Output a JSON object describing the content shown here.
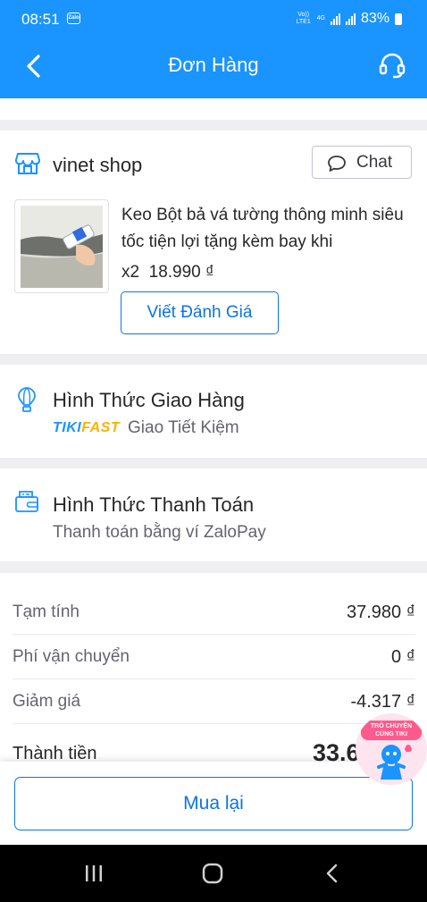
{
  "status_bar": {
    "time": "08:51",
    "notification_app": "Zalo",
    "volte_label": "Vo)) LTE1",
    "network_label": "4G",
    "battery": "83%"
  },
  "header": {
    "title": "Đơn Hàng",
    "back_icon": "chevron-left-icon",
    "support_icon": "headset-icon"
  },
  "shop": {
    "name": "vinet shop",
    "chat_label": "Chat"
  },
  "product": {
    "name": "Keo Bột bả vá tường thông minh siêu tốc tiện lợi tặng kèm bay khi",
    "quantity": "x2",
    "price": "18.990 ₫",
    "review_label": "Viết Đánh Giá"
  },
  "shipping": {
    "title": "Hình Thức Giao Hàng",
    "logo_tiki": "TIKI",
    "logo_fast": "FAST",
    "method": "Giao Tiết Kiệm"
  },
  "payment": {
    "title": "Hình Thức Thanh Toán",
    "method": "Thanh toán bằng ví ZaloPay"
  },
  "summary": {
    "rows": [
      {
        "label": "Tạm tính",
        "value": "37.980 ₫"
      },
      {
        "label": "Phí vận chuyển",
        "value": "0 ₫"
      },
      {
        "label": "Giảm giá",
        "value": "-4.317 ₫"
      }
    ],
    "total_label": "Thành tiền",
    "total_value": "33.6"
  },
  "bottom": {
    "rebuy_label": "Mua lại"
  },
  "chat_bubble": {
    "line1": "TRÒ CHUYỆN",
    "line2": "CÙNG TIKI"
  },
  "colors": {
    "brand_blue": "#1a94ff",
    "button_blue": "#0b74e5",
    "tikifast_orange": "#ffb000",
    "bubble_pink": "#ff5a8c"
  }
}
